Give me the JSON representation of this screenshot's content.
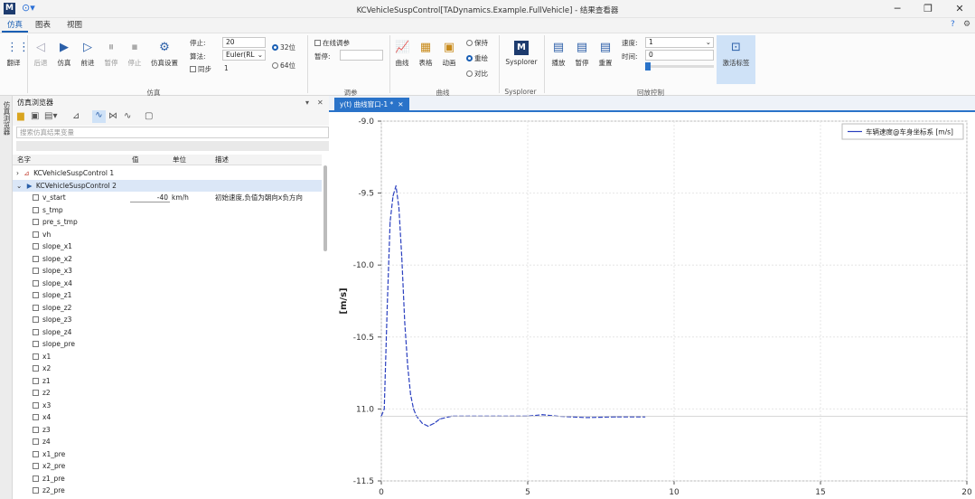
{
  "app": {
    "title": "KCVehicleSuspControl[TADynamics.Example.FullVehicle] - 结果查看器"
  },
  "menu": {
    "tabs": [
      "仿真",
      "图表",
      "视图"
    ]
  },
  "ribbon": {
    "buttons": {
      "translate": "翻译",
      "back": "后退",
      "simulate": "仿真",
      "forward": "前进",
      "pause": "暂停",
      "stop": "停止",
      "sim_settings": "仿真设置",
      "curve": "曲线",
      "table": "表格",
      "animation": "动画",
      "sysplorer": "Sysplorer",
      "play": "播放",
      "pause2": "暂停",
      "reset": "重置",
      "set_label": "激活标签"
    },
    "fields": {
      "stop_label": "停止:",
      "stop_value": "20",
      "algo_label": "算法:",
      "algo_value": "Euler(RL",
      "sync_label": "同步",
      "sync_value": "1",
      "bit32": "32位",
      "bit64": "64位",
      "online_params": "在线调参",
      "pause_label": "暂停:",
      "keep": "保持",
      "overwrite": "重绘",
      "compare": "对比",
      "speed_label": "速度:",
      "speed_value": "1",
      "time_label": "时间:",
      "time_value": "0"
    },
    "groups": [
      "仿真",
      "调参",
      "曲线",
      "Sysplorer",
      "回放控制"
    ]
  },
  "sidebar_strip": "仿真浏览器",
  "browser": {
    "title": "仿真浏览器",
    "search_placeholder": "搜索仿真结果变量",
    "columns": [
      "名字",
      "值",
      "单位",
      "描述"
    ],
    "nodes": [
      "KCVehicleSuspControl 1",
      "KCVehicleSuspControl 2"
    ],
    "vars": [
      {
        "name": "v_start",
        "value": "-40",
        "unit": "km/h",
        "desc": "初始速度,负值为朝向x负方向"
      },
      {
        "name": "s_tmp"
      },
      {
        "name": "pre_s_tmp"
      },
      {
        "name": "vh"
      },
      {
        "name": "slope_x1"
      },
      {
        "name": "slope_x2"
      },
      {
        "name": "slope_x3"
      },
      {
        "name": "slope_x4"
      },
      {
        "name": "slope_z1"
      },
      {
        "name": "slope_z2"
      },
      {
        "name": "slope_z3"
      },
      {
        "name": "slope_z4"
      },
      {
        "name": "slope_pre"
      },
      {
        "name": "x1"
      },
      {
        "name": "x2"
      },
      {
        "name": "z1"
      },
      {
        "name": "z2"
      },
      {
        "name": "x3"
      },
      {
        "name": "x4"
      },
      {
        "name": "z3"
      },
      {
        "name": "z4"
      },
      {
        "name": "x1_pre"
      },
      {
        "name": "x2_pre"
      },
      {
        "name": "z1_pre"
      },
      {
        "name": "z2_pre"
      }
    ]
  },
  "plot_tab": "y(t) 曲线窗口-1 *",
  "chart_data": {
    "type": "line",
    "ylabel": "[m/s]",
    "xlabel": "",
    "xlim": [
      0,
      20
    ],
    "ylim": [
      -11.5,
      -9.0
    ],
    "xticks": [
      "0",
      "5",
      "10",
      "15",
      "20"
    ],
    "yticks": [
      "-9.0",
      "-9.5",
      "-10.0",
      "-10.5",
      "11.0",
      "-11.5"
    ],
    "legend_position": "top-right",
    "series": [
      {
        "name": "车辆速度@车身坐标系 [m/s]",
        "color": "#2a3fbf",
        "x": [
          0.0,
          0.1,
          0.2,
          0.3,
          0.4,
          0.5,
          0.6,
          0.7,
          0.8,
          0.9,
          1.0,
          1.1,
          1.2,
          1.4,
          1.6,
          1.8,
          2.0,
          2.4,
          3.0,
          4.0,
          5.0,
          5.5,
          6.0,
          7.0,
          8.0,
          9.0
        ],
        "y": [
          -11.05,
          -11.0,
          -10.3,
          -9.7,
          -9.52,
          -9.45,
          -9.6,
          -9.95,
          -10.4,
          -10.7,
          -10.9,
          -11.0,
          -11.05,
          -11.1,
          -11.12,
          -11.1,
          -11.07,
          -11.05,
          -11.05,
          -11.05,
          -11.05,
          -11.04,
          -11.05,
          -11.06,
          -11.055,
          -11.055
        ]
      }
    ]
  }
}
